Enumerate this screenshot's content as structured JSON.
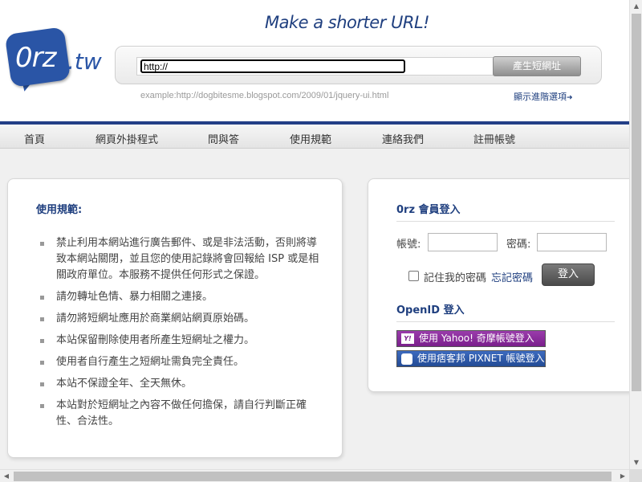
{
  "header": {
    "logo_text": "0rz",
    "logo_tld": ".tw",
    "tagline": "Make a shorter URL!",
    "url_input_value": "http://",
    "shorten_button": "產生短網址",
    "example": "example:http://dogbitesme.blogspot.com/2009/01/jquery-ui.html",
    "advanced_link": "顯示進階選項",
    "advanced_arrow": "➜"
  },
  "nav": {
    "items": [
      {
        "label": "首頁"
      },
      {
        "label": "網頁外掛程式"
      },
      {
        "label": "問與答"
      },
      {
        "label": "使用規範"
      },
      {
        "label": "連絡我們"
      },
      {
        "label": "註冊帳號"
      }
    ]
  },
  "rules": {
    "title": "使用規範:",
    "items": [
      "禁止利用本網站進行廣告郵件、或是非法活動，否則將導致本網站關閉，並且您的使用記錄將會回報給 ISP 或是相關政府單位。本服務不提供任何形式之保證。",
      "請勿轉址色情、暴力相關之連接。",
      "請勿將短網址應用於商業網站網頁原始碼。",
      "本站保留刪除使用者所產生短網址之權力。",
      "使用者自行產生之短網址需負完全責任。",
      "本站不保證全年、全天無休。",
      "本站對於短網址之內容不做任何擔保，請自行判斷正確性、合法性。"
    ]
  },
  "login": {
    "title": "0rz 會員登入",
    "account_label": "帳號:",
    "password_label": "密碼:",
    "remember_label": "記住我的密碼",
    "forgot_link": "忘記密碼",
    "login_button": "登入",
    "openid_title": "OpenID 登入",
    "yahoo_button": "使用 Yahoo! 奇摩帳號登入",
    "yahoo_icon_text": "Y!",
    "pixnet_button": "使用痞客邦 PIXNET 帳號登入"
  },
  "colors": {
    "brand_blue": "#2a55a6",
    "nav_bar": "#233f87",
    "yahoo_purple": "#7a1f8c",
    "pixnet_blue": "#234b95"
  },
  "icons": {
    "scroll_up": "▲",
    "scroll_down": "▼",
    "scroll_left": "◀",
    "scroll_right": "▶"
  }
}
